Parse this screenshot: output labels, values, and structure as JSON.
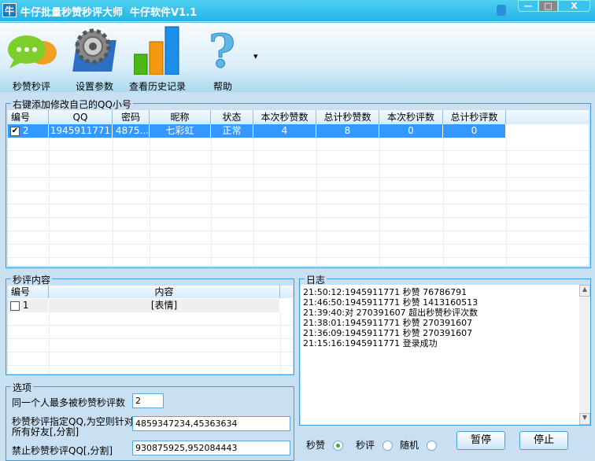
{
  "window": {
    "logo_char": "牛",
    "title": "牛仔批量秒赞秒评大师  牛仔软件V1.1",
    "minimize": "—",
    "maximize": "□",
    "close": "X"
  },
  "toolbar": {
    "items": [
      {
        "label": "秒赞秒评",
        "icon": "chat-bubbles-icon"
      },
      {
        "label": "设置参数",
        "icon": "gear-icon"
      },
      {
        "label": "查看历史记录",
        "icon": "bar-chart-icon"
      },
      {
        "label": "帮助",
        "icon": "question-icon"
      }
    ],
    "more": "▾"
  },
  "accounts": {
    "legend": "右键添加修改自己的QQ小号",
    "columns": [
      "编号",
      "QQ",
      "密码",
      "昵称",
      "状态",
      "本次秒赞数",
      "总计秒赞数",
      "本次秒评数",
      "总计秒评数"
    ],
    "rows": [
      {
        "checked": true,
        "id": "2",
        "qq": "1945911771",
        "password": "4875...",
        "nickname": "七彩虹",
        "status": "正常",
        "like_now": "4",
        "like_total": "8",
        "comment_now": "0",
        "comment_total": "0"
      }
    ]
  },
  "comments": {
    "legend": "秒评内容",
    "columns": [
      "编号",
      "内容"
    ],
    "rows": [
      {
        "checked": false,
        "id": "1",
        "content": "[表情]"
      }
    ]
  },
  "options": {
    "legend": "选项",
    "max_label": "同一个人最多被秒赞秒评数",
    "max_value": "2",
    "target_label": "秒赞秒评指定QQ,为空则针对所有好友[,分割]",
    "target_value": "4859347234,45363634",
    "ban_label": "禁止秒赞秒评QQ[,分割]",
    "ban_value": "930875925,952084443"
  },
  "log": {
    "legend": "日志",
    "lines": [
      "21:50:12:1945911771 秒赞 76786791",
      "21:46:50:1945911771 秒赞 1413160513",
      "21:39:40:对 270391607 超出秒赞秒评次数",
      "21:38:01:1945911771 秒赞 270391607",
      "21:36:09:1945911771 秒赞 270391607",
      "21:15:16:1945911771 登录成功"
    ]
  },
  "mode": {
    "options": [
      "秒赞",
      "秒评",
      "随机"
    ],
    "selected": "秒赞"
  },
  "buttons": {
    "pause": "暂停",
    "stop": "停止"
  }
}
